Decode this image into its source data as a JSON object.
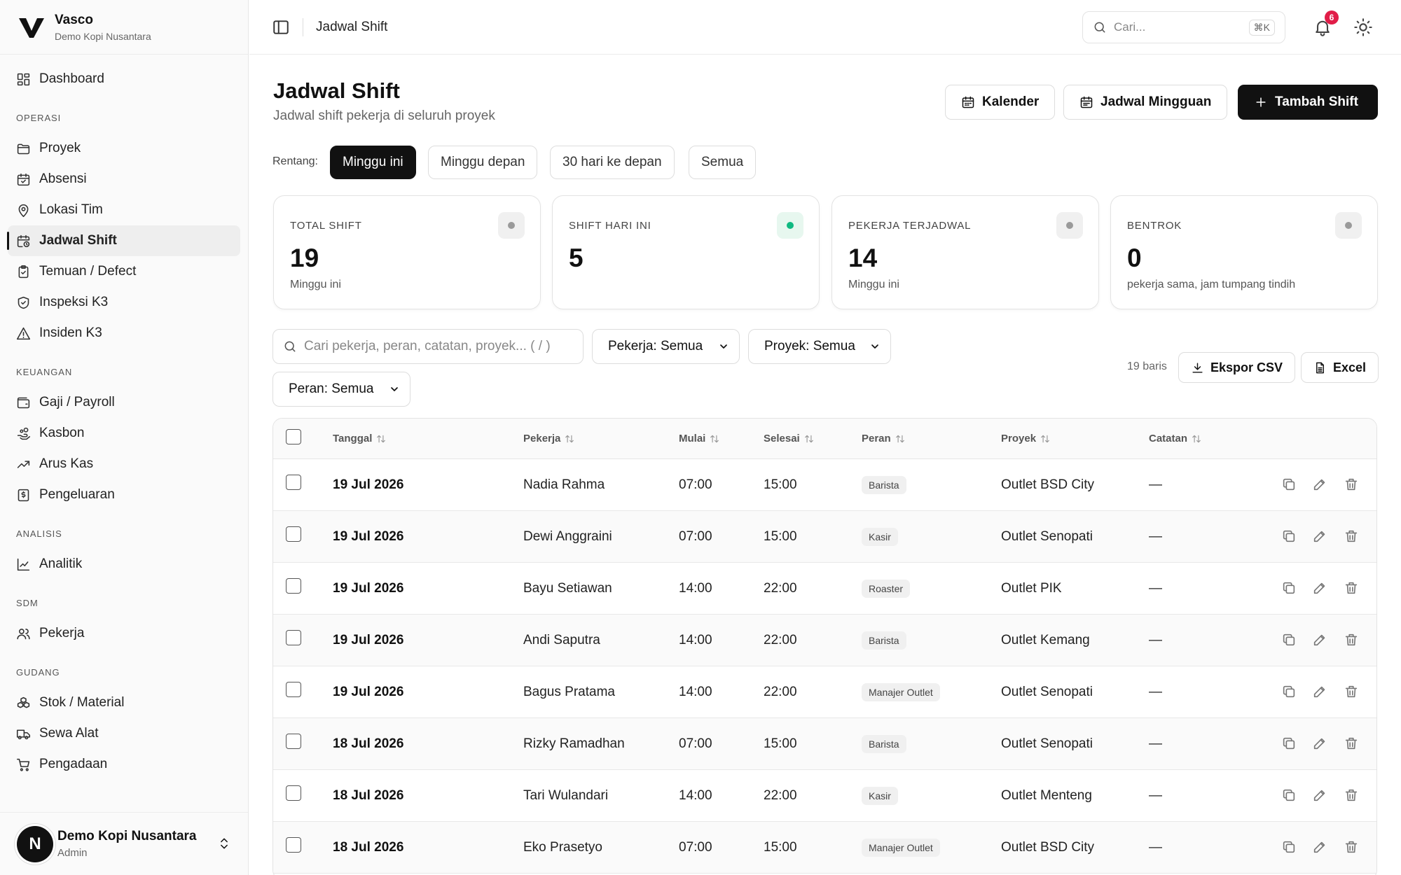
{
  "sidebar": {
    "brand_name": "Vasco",
    "brand_sub": "Demo Kopi Nusantara",
    "dashboard": "Dashboard",
    "sections": [
      {
        "title": "OPERASI",
        "items": [
          "Proyek",
          "Absensi",
          "Lokasi Tim",
          "Jadwal Shift",
          "Temuan / Defect",
          "Inspeksi K3",
          "Insiden K3"
        ]
      },
      {
        "title": "KEUANGAN",
        "items": [
          "Gaji / Payroll",
          "Kasbon",
          "Arus Kas",
          "Pengeluaran"
        ]
      },
      {
        "title": "ANALISIS",
        "items": [
          "Analitik"
        ]
      },
      {
        "title": "SDM",
        "items": [
          "Pekerja"
        ]
      },
      {
        "title": "GUDANG",
        "items": [
          "Stok / Material",
          "Sewa Alat",
          "Pengadaan"
        ]
      }
    ],
    "active_item": "Jadwal Shift",
    "user": {
      "initial": "N",
      "name": "Demo Kopi Nusantara",
      "role": "Admin"
    }
  },
  "topbar": {
    "title": "Jadwal Shift",
    "search_placeholder": "Cari...",
    "search_shortcut": "⌘K",
    "notif_count": "6"
  },
  "header": {
    "title": "Jadwal Shift",
    "subtitle": "Jadwal shift pekerja di seluruh proyek",
    "buttons": {
      "calendar": "Kalender",
      "weekly": "Jadwal Mingguan",
      "add": "Tambah Shift"
    }
  },
  "range": {
    "label": "Rentang:",
    "options": [
      "Minggu ini",
      "Minggu depan",
      "30 hari ke depan",
      "Semua"
    ],
    "selected": "Minggu ini"
  },
  "stats": [
    {
      "label": "TOTAL SHIFT",
      "value": "19",
      "note": "Minggu ini",
      "dot": "gray"
    },
    {
      "label": "SHIFT HARI INI",
      "value": "5",
      "note": "",
      "dot": "green"
    },
    {
      "label": "PEKERJA TERJADWAL",
      "value": "14",
      "note": "Minggu ini",
      "dot": "gray"
    },
    {
      "label": "BENTROK",
      "value": "0",
      "note": "pekerja sama, jam tumpang tindih",
      "dot": "gray"
    }
  ],
  "filters": {
    "search_placeholder": "Cari pekerja, peran, catatan, proyek...  ( / )",
    "worker": "Pekerja: Semua",
    "project": "Proyek: Semua",
    "role": "Peran: Semua",
    "rows_count": "19 baris",
    "export_csv": "Ekspor CSV",
    "excel": "Excel"
  },
  "table": {
    "columns": [
      "Tanggal",
      "Pekerja",
      "Mulai",
      "Selesai",
      "Peran",
      "Proyek",
      "Catatan"
    ],
    "rows": [
      {
        "date": "19 Jul 2026",
        "worker": "Nadia Rahma",
        "start": "07:00",
        "end": "15:00",
        "role": "Barista",
        "project": "Outlet BSD City",
        "note": "—"
      },
      {
        "date": "19 Jul 2026",
        "worker": "Dewi Anggraini",
        "start": "07:00",
        "end": "15:00",
        "role": "Kasir",
        "project": "Outlet Senopati",
        "note": "—"
      },
      {
        "date": "19 Jul 2026",
        "worker": "Bayu Setiawan",
        "start": "14:00",
        "end": "22:00",
        "role": "Roaster",
        "project": "Outlet PIK",
        "note": "—"
      },
      {
        "date": "19 Jul 2026",
        "worker": "Andi Saputra",
        "start": "14:00",
        "end": "22:00",
        "role": "Barista",
        "project": "Outlet Kemang",
        "note": "—"
      },
      {
        "date": "19 Jul 2026",
        "worker": "Bagus Pratama",
        "start": "14:00",
        "end": "22:00",
        "role": "Manajer Outlet",
        "project": "Outlet Senopati",
        "note": "—"
      },
      {
        "date": "18 Jul 2026",
        "worker": "Rizky Ramadhan",
        "start": "07:00",
        "end": "15:00",
        "role": "Barista",
        "project": "Outlet Senopati",
        "note": "—"
      },
      {
        "date": "18 Jul 2026",
        "worker": "Tari Wulandari",
        "start": "14:00",
        "end": "22:00",
        "role": "Kasir",
        "project": "Outlet Menteng",
        "note": "—"
      },
      {
        "date": "18 Jul 2026",
        "worker": "Eko Prasetyo",
        "start": "07:00",
        "end": "15:00",
        "role": "Manajer Outlet",
        "project": "Outlet BSD City",
        "note": "—"
      }
    ]
  },
  "colors": {
    "accent": "#111111",
    "badge": "#e11d48",
    "green_dot": "#10b981"
  }
}
